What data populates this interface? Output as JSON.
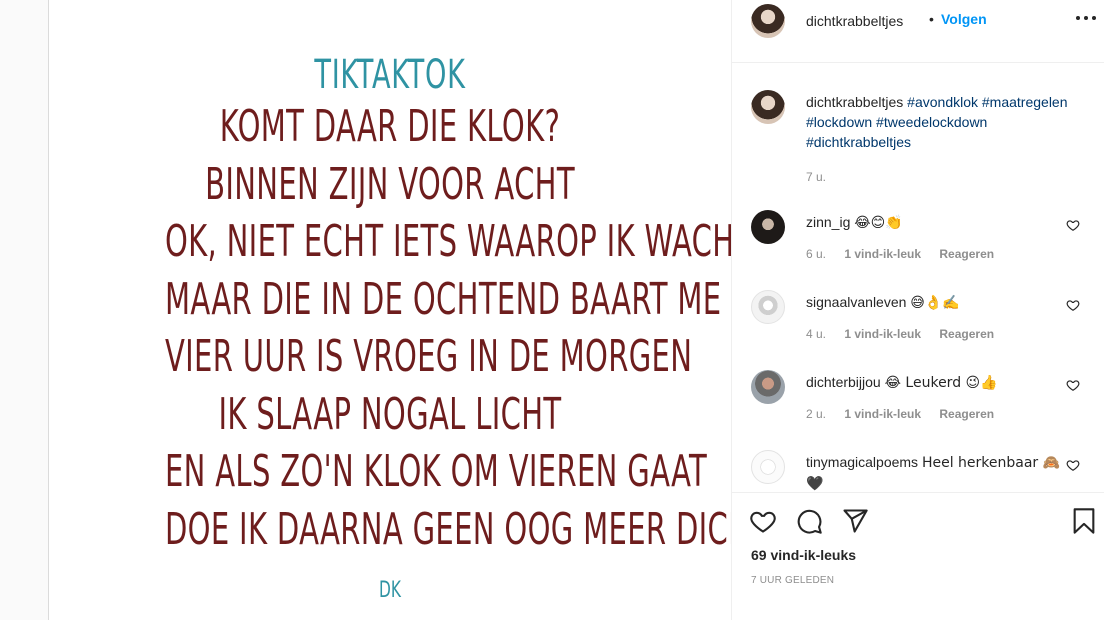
{
  "poem": {
    "title": "TIKTAKTOK",
    "lines": [
      "KOMT DAAR DIE KLOK?",
      "BINNEN ZIJN VOOR ACHT",
      "OK, NIET ECHT IETS WAAROP IK WACHT",
      "MAAR DIE IN DE OCHTEND BAART ME ZORGEN",
      "VIER UUR IS VROEG IN DE MORGEN",
      "IK SLAAP NOGAL LICHT",
      "EN ALS ZO'N KLOK OM VIEREN GAAT",
      "DOE IK DAARNA GEEN OOG MEER DICHT"
    ],
    "signature": "DK"
  },
  "header": {
    "username": "dichtkrabbeltjes",
    "separator": "•",
    "follow_label": "Volgen",
    "more_icon": "more-horizontal-icon"
  },
  "caption": {
    "username": "dichtkrabbeltjes",
    "hashtags": [
      "#avondklok",
      "#maatregelen",
      "#lockdown",
      "#tweedelockdown",
      "#dichtkrabbeltjes"
    ],
    "time": "7 u."
  },
  "comments": [
    {
      "username": "zinn_ig",
      "text": "😂😊👏",
      "time": "6 u.",
      "likes": "1 vind-ik-leuk",
      "reply": "Reageren"
    },
    {
      "username": "signaalvanleven",
      "text": "😅👌✍️",
      "time": "4 u.",
      "likes": "1 vind-ik-leuk",
      "reply": "Reageren"
    },
    {
      "username": "dichterbijjou",
      "text": "😂 Leukerd 😉👍",
      "time": "2 u.",
      "likes": "1 vind-ik-leuk",
      "reply": "Reageren"
    },
    {
      "username": "tinymagicalpoems",
      "text": "Heel herkenbaar 🙈🖤"
    }
  ],
  "actions": {
    "likes": "69 vind-ik-leuks",
    "posted": "7 UUR GELEDEN"
  }
}
